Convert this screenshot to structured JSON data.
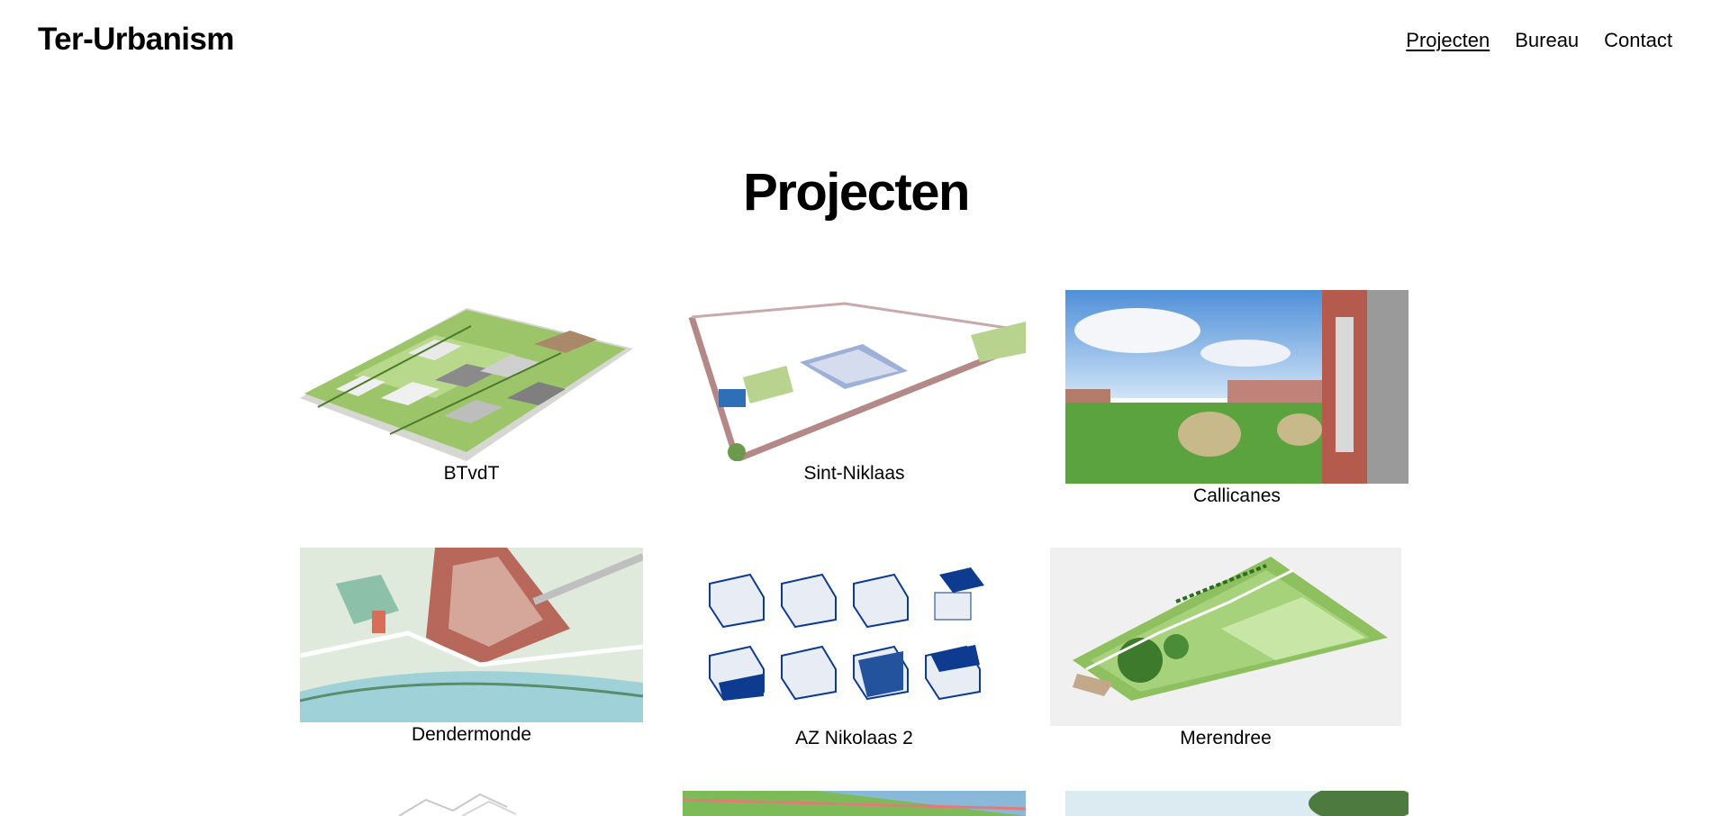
{
  "header": {
    "logo": "Ter-Urbanism",
    "nav": [
      {
        "label": "Projecten",
        "active": true
      },
      {
        "label": "Bureau",
        "active": false
      },
      {
        "label": "Contact",
        "active": false
      }
    ]
  },
  "main": {
    "title": "Projecten",
    "projects": [
      {
        "name": "BTvdT"
      },
      {
        "name": "Sint-Niklaas"
      },
      {
        "name": "Callicanes"
      },
      {
        "name": "Dendermonde"
      },
      {
        "name": "AZ Nikolaas 2"
      },
      {
        "name": "Merendree"
      }
    ]
  },
  "colors": {
    "accent": "#0d3b8f",
    "text": "#000000",
    "grass": "#8fc060"
  }
}
